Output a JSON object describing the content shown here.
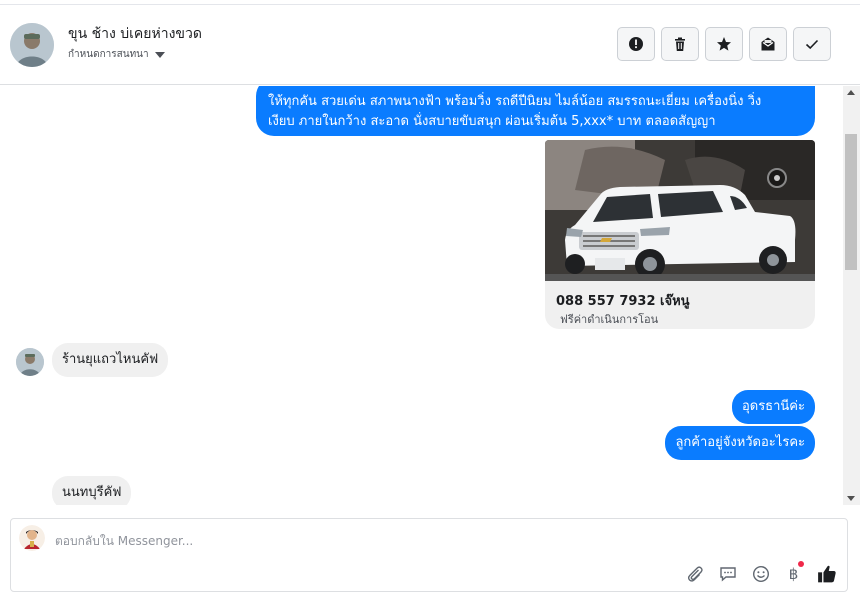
{
  "header": {
    "contact_name": "ขุน ช้าง บ่เคยห่างขวด",
    "assign_label": "กำหนดการสนทนา",
    "toolbar": [
      {
        "name": "mark-spam-button",
        "icon": "alert-circle-icon"
      },
      {
        "name": "delete-button",
        "icon": "trash-icon"
      },
      {
        "name": "star-button",
        "icon": "star-icon"
      },
      {
        "name": "mark-unread-button",
        "icon": "envelope-icon"
      },
      {
        "name": "mark-done-button",
        "icon": "check-icon"
      }
    ]
  },
  "messages": {
    "outgoing_promo": {
      "line1": "ให้ทุกคัน สวยเด่น สภาพนางฟ้า พร้อมวิ่ง รถดีปีนิยม ไมล์น้อย สมรรถนะเยี่ยม เครื่องนิ่ง วิ่ง",
      "line2": "เงียบ ภายในกว้าง สะอาด นั่งสบายขับสนุก ผ่อนเริ่มต้น 5,xxx* บาท ตลอดสัญญา"
    },
    "card": {
      "title": "088 557 7932 เจ๊หนู",
      "subtitle": "ฟรีค่าดำเนินการโอน"
    },
    "incoming_1": "ร้านยุแถวไหนคัฟ",
    "outgoing_1": "อุดรธานีค่ะ",
    "outgoing_2": "ลูกค้าอยู่จังหวัดอะไรคะ",
    "incoming_2": "นนทบุรีคัฟ"
  },
  "composer": {
    "placeholder": "ตอบกลับใน Messenger...",
    "currency_symbol": "฿"
  },
  "colors": {
    "outgoing_bubble": "#0a7cff",
    "incoming_bubble": "#f0f0f0",
    "notification_dot": "#f02849"
  }
}
